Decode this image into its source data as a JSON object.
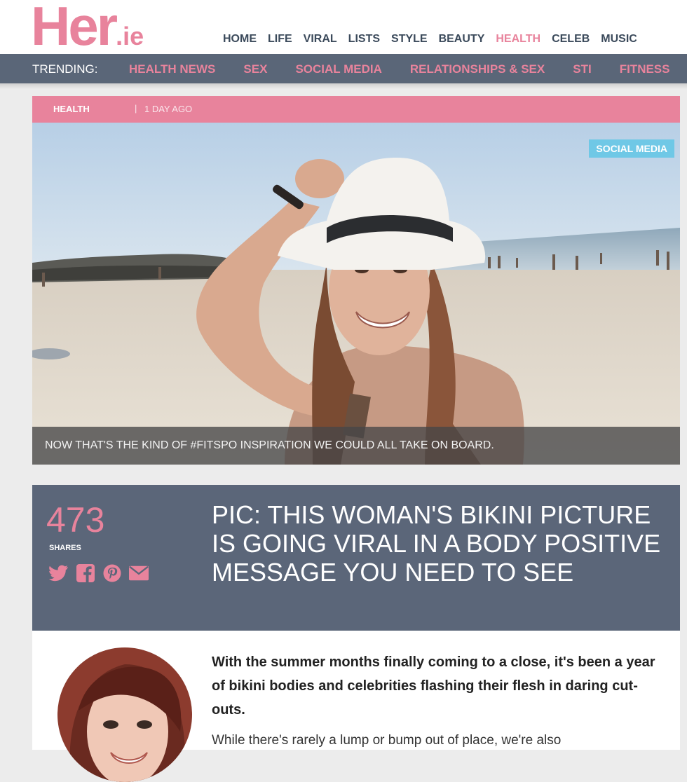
{
  "site": {
    "logo_main": "Her",
    "logo_tld": ".ie"
  },
  "nav": {
    "items": [
      "HOME",
      "LIFE",
      "VIRAL",
      "LISTS",
      "STYLE",
      "BEAUTY",
      "HEALTH",
      "CELEB",
      "MUSIC"
    ],
    "active": "HEALTH"
  },
  "trending": {
    "label": "TRENDING:",
    "items": [
      "HEALTH NEWS",
      "SEX",
      "SOCIAL MEDIA",
      "RELATIONSHIPS & SEX",
      "STI",
      "FITNESS"
    ]
  },
  "article": {
    "category": "HEALTH",
    "separator": "|",
    "time": "1 DAY AGO",
    "tag": "SOCIAL MEDIA",
    "caption": "NOW THAT'S THE KIND OF #FITSPO INSPIRATION WE COULD ALL TAKE ON BOARD.",
    "shares_count": "473",
    "shares_label": "SHARES",
    "title": "PIC: THIS WOMAN'S BIKINI PICTURE IS GOING VIRAL IN A BODY POSITIVE MESSAGE YOU NEED TO SEE",
    "lead": "With the summer months finally coming to a close, it's been a year of bikini bodies and celebrities flashing their flesh in daring cut-outs.",
    "paragraph": "While there's rarely a lump or bump out of place, we're also"
  },
  "social_icons": [
    "twitter-icon",
    "facebook-icon",
    "pinterest-icon",
    "email-icon"
  ],
  "colors": {
    "brand_pink": "#e8839c",
    "slate": "#5b6679",
    "tag_blue": "#6fc8e6"
  }
}
